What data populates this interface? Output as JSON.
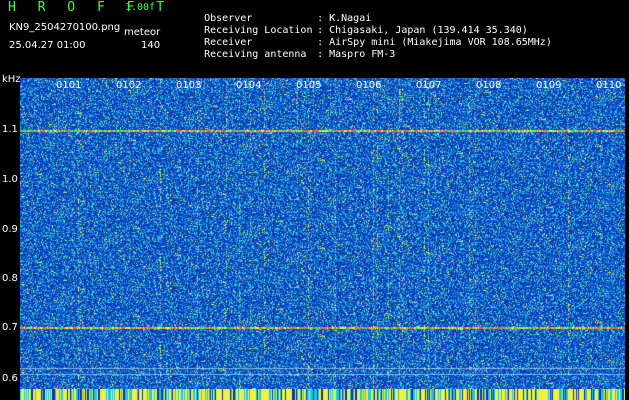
{
  "header": {
    "logo": "H R O F F T",
    "version": "1.00f",
    "filename": "KN9_2504270100.png",
    "user": "meteor",
    "datetime": "25.04.27 01:00",
    "count": "140"
  },
  "station": {
    "observer_label": "Observer",
    "observer_value": "K.Nagai",
    "location_label": "Receiving Location",
    "location_value": "Chigasaki, Japan (139.414 35.340)",
    "receiver_label": "Receiver",
    "receiver_value": "AirSpy mini (Miakejima VOR 108.65MHz)",
    "antenna_label": "Receiving antenna",
    "antenna_value": "Maspro FM-3",
    "separator": ":"
  },
  "axis": {
    "y_unit": "kHz",
    "y_ticks": [
      "1.1",
      "1.0",
      "0.9",
      "0.8",
      "0.7",
      "0.6"
    ],
    "x_ticks": [
      "0101",
      "0102",
      "0103",
      "0104",
      "0105",
      "0106",
      "0107",
      "0108",
      "0109",
      "0110"
    ]
  },
  "colors": {
    "background": "#000000",
    "noise_low": "#0a2fb0",
    "noise_mid": "#19c8e6",
    "noise_high": "#f2f23a",
    "carrier": "#ff5a3c",
    "logo": "#39ff39"
  }
}
